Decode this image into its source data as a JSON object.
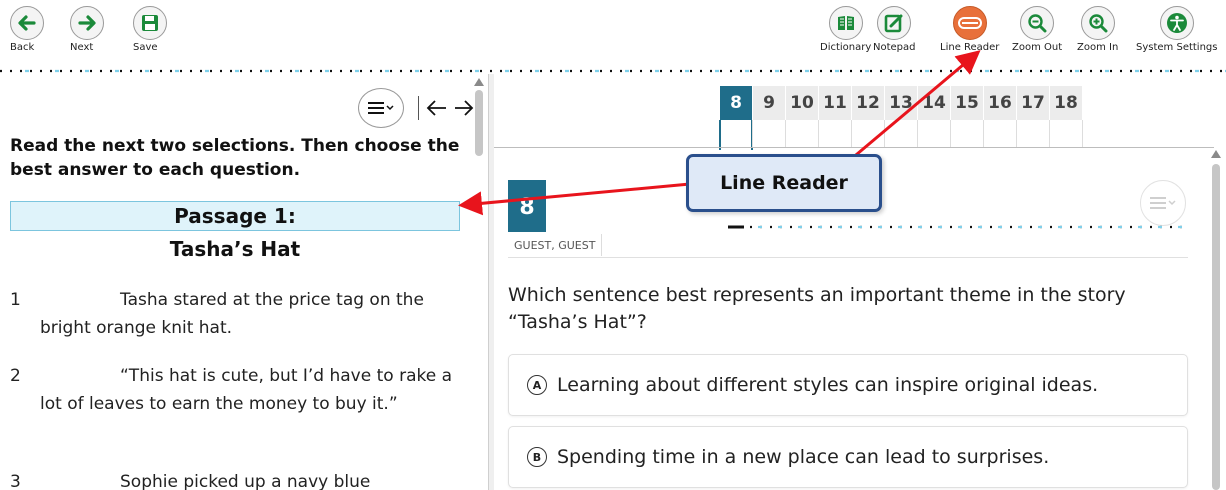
{
  "toolbar": {
    "back_label": "Back",
    "next_label": "Next",
    "save_label": "Save",
    "dictionary_label": "Dictionary",
    "notepad_label": "Notepad",
    "line_reader_label": "Line Reader",
    "zoom_out_label": "Zoom Out",
    "zoom_in_label": "Zoom In",
    "system_settings_label": "System Settings",
    "icons": [
      "arrow-left-icon",
      "arrow-right-icon",
      "save-icon",
      "book-icon",
      "notepad-icon",
      "line-reader-icon",
      "zoom-out-icon",
      "zoom-in-icon",
      "accessibility-icon"
    ],
    "line_reader_active_color": "#e8703a"
  },
  "passage": {
    "instructions": "Read the next two selections. Then choose the best answer to each question.",
    "banner": "Passage 1:",
    "title": "Tasha’s Hat",
    "paragraphs": [
      {
        "num": "1",
        "text": "Tasha stared at the price tag on the bright orange knit hat."
      },
      {
        "num": "2",
        "text": "“This hat is cute, but I’d have to rake a lot of leaves to earn the money to buy it.”"
      },
      {
        "num": "3",
        "text": "Sophie picked up a navy blue"
      }
    ],
    "banner_color": "#dff3fa"
  },
  "tabs": {
    "items": [
      "8",
      "9",
      "10",
      "11",
      "12",
      "13",
      "14",
      "15",
      "16",
      "17",
      "18"
    ],
    "active": "8",
    "active_color": "#1f6d8a"
  },
  "question": {
    "number": "8",
    "user": "GUEST, GUEST",
    "text": "Which sentence best represents an important theme in the story “Tasha’s Hat”?",
    "options": [
      {
        "letter": "A",
        "text": "Learning about different styles can inspire original ideas."
      },
      {
        "letter": "B",
        "text": "Spending time in a new place can lead to surprises."
      }
    ]
  },
  "callout": {
    "text": "Line Reader",
    "arrow_color": "#e8141c",
    "border_color": "#2a4f8c"
  }
}
